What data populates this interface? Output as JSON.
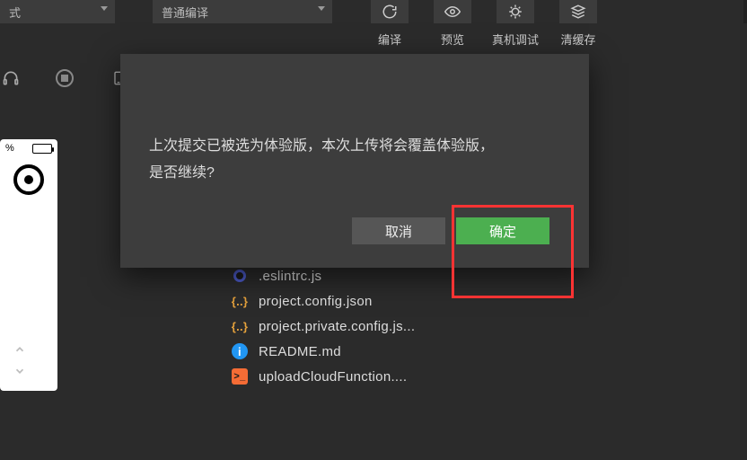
{
  "toolbar": {
    "mode_dropdown": "式",
    "compile_dropdown": "普通编译",
    "buttons": {
      "compile": "编译",
      "preview": "预览",
      "real_debug": "真机调试",
      "clear_cache": "清缓存"
    }
  },
  "simulator": {
    "battery_label": "%"
  },
  "modal": {
    "line1": "上次提交已被选为体验版，本次上传将会覆盖体验版，",
    "line2": "是否继续?",
    "cancel": "取消",
    "ok": "确定"
  },
  "files": [
    {
      "icon": "ring",
      "name": ".eslintrc.js"
    },
    {
      "icon": "brace",
      "name": "project.config.json"
    },
    {
      "icon": "brace",
      "name": "project.private.config.js..."
    },
    {
      "icon": "info",
      "name": "README.md"
    },
    {
      "icon": "term",
      "name": "uploadCloudFunction...."
    }
  ]
}
